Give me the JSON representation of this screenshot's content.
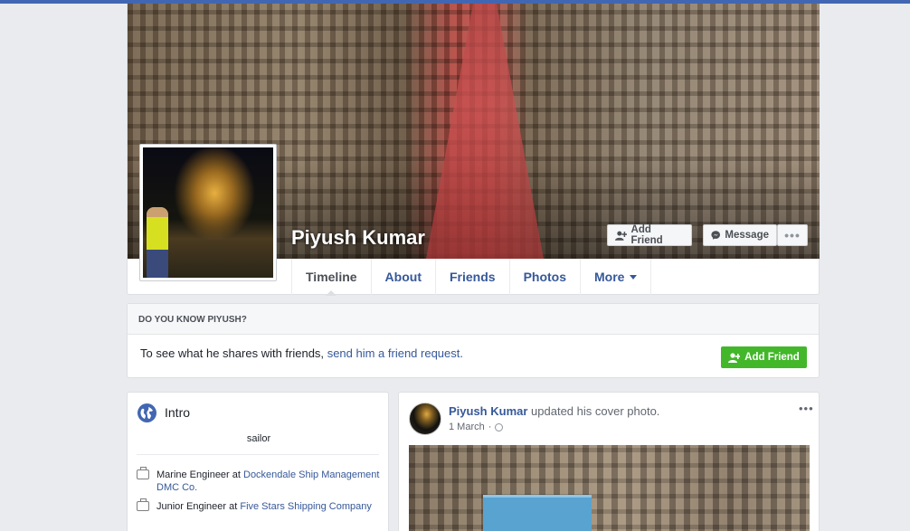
{
  "profile": {
    "name": "Piyush Kumar",
    "buttons": {
      "add_friend": "Add Friend",
      "message": "Message",
      "more": "•••"
    },
    "tabs": [
      {
        "label": "Timeline",
        "active": true
      },
      {
        "label": "About"
      },
      {
        "label": "Friends"
      },
      {
        "label": "Photos"
      },
      {
        "label": "More"
      }
    ]
  },
  "know": {
    "heading": "DO YOU KNOW PIYUSH?",
    "text": "To see what he shares with friends,",
    "link": "send him a friend request.",
    "button": "Add Friend"
  },
  "intro": {
    "title": "Intro",
    "bio": "sailor",
    "jobs": [
      {
        "role": "Marine Engineer at ",
        "company": "Dockendale Ship Management DMC Co."
      },
      {
        "role": "Junior Engineer at ",
        "company": "Five Stars Shipping Company"
      }
    ]
  },
  "post": {
    "author": "Piyush Kumar",
    "action": " updated his cover photo.",
    "date": "1 March",
    "separator": "·",
    "menu": "•••"
  },
  "colors": {
    "brand": "#4267b2",
    "link": "#365899",
    "green": "#42b72a",
    "background": "#e9ebee"
  }
}
